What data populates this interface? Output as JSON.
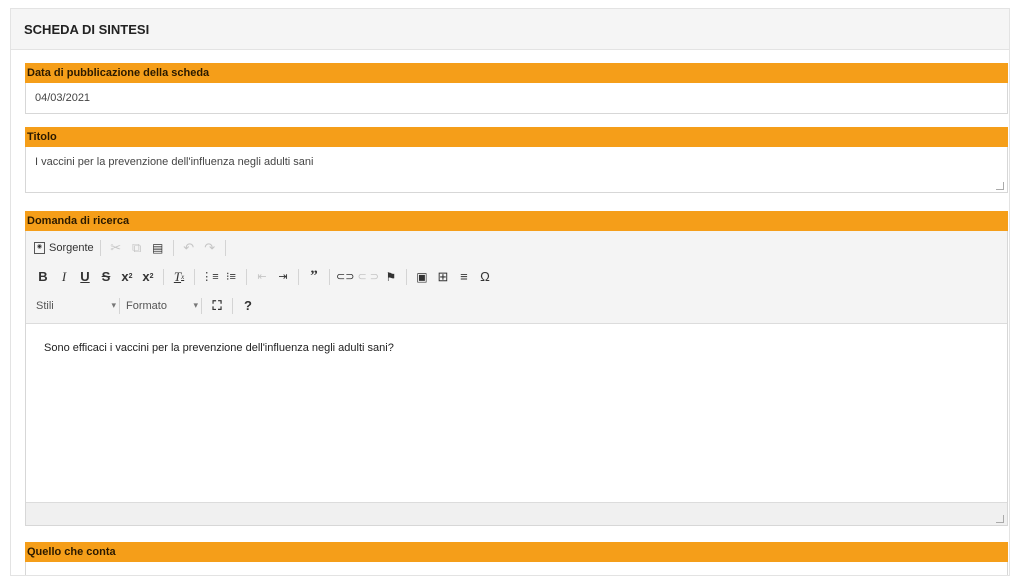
{
  "panel": {
    "title": "SCHEDA DI SINTESI"
  },
  "fields": {
    "data_pubblicazione": {
      "label": "Data di pubblicazione della scheda",
      "value": "04/03/2021"
    },
    "titolo": {
      "label": "Titolo",
      "value": "I vaccini per la prevenzione dell'influenza negli adulti sani"
    },
    "domanda": {
      "label": "Domanda di ricerca",
      "value": "Sono efficaci i vaccini per la prevenzione dell'influenza negli adulti sani?"
    },
    "quello_che_conta": {
      "label": "Quello che conta"
    }
  },
  "toolbar": {
    "source_label": "Sorgente",
    "styles_label": "Stili",
    "format_label": "Formato",
    "help_glyph": "?",
    "bold_glyph": "B",
    "italic_glyph": "I",
    "underline_glyph": "U",
    "strike_glyph": "S",
    "omega_glyph": "Ω"
  },
  "colors": {
    "section_bar": "#f59e19",
    "panel_header_bg": "#f5f5f5"
  }
}
